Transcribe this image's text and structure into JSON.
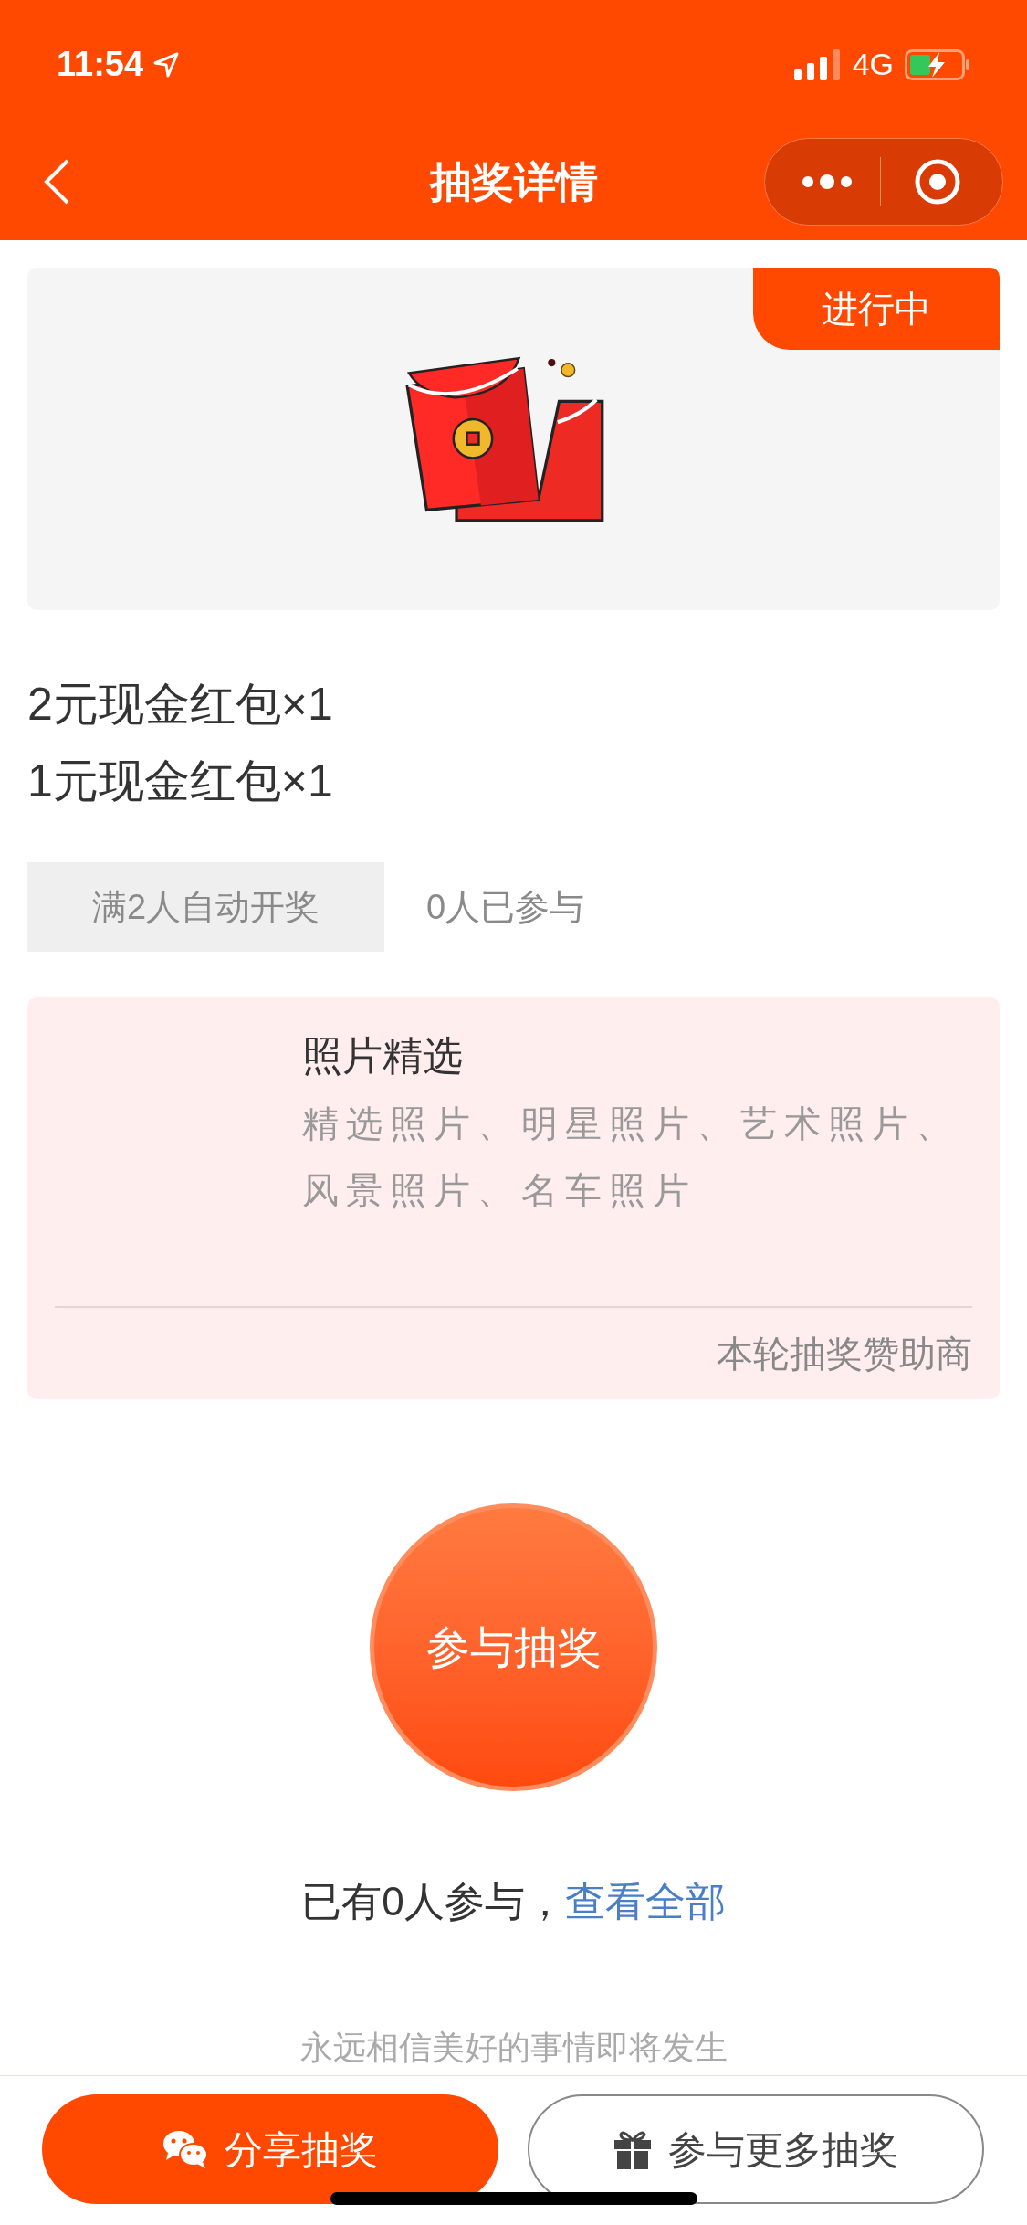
{
  "status_bar": {
    "time": "11:54",
    "network": "4G"
  },
  "nav": {
    "title": "抽奖详情"
  },
  "banner": {
    "badge": "进行中"
  },
  "prizes": [
    "2元现金红包×1",
    "1元现金红包×1"
  ],
  "draw_rule": {
    "tag": "满2人自动开奖",
    "participants": "0人已参与"
  },
  "sponsor": {
    "title": "照片精选",
    "description": "精选照片、明星照片、艺术照片、风景照片、名车照片",
    "footer": "本轮抽奖赞助商"
  },
  "join_button": "参与抽奖",
  "summary": {
    "text": "已有0人参与，",
    "link": "查看全部"
  },
  "motto": "永远相信美好的事情即将发生",
  "bottom_buttons": [
    {
      "kind": "share",
      "label": "分享抽奖"
    },
    {
      "kind": "more",
      "label": "参与更多抽奖"
    }
  ]
}
